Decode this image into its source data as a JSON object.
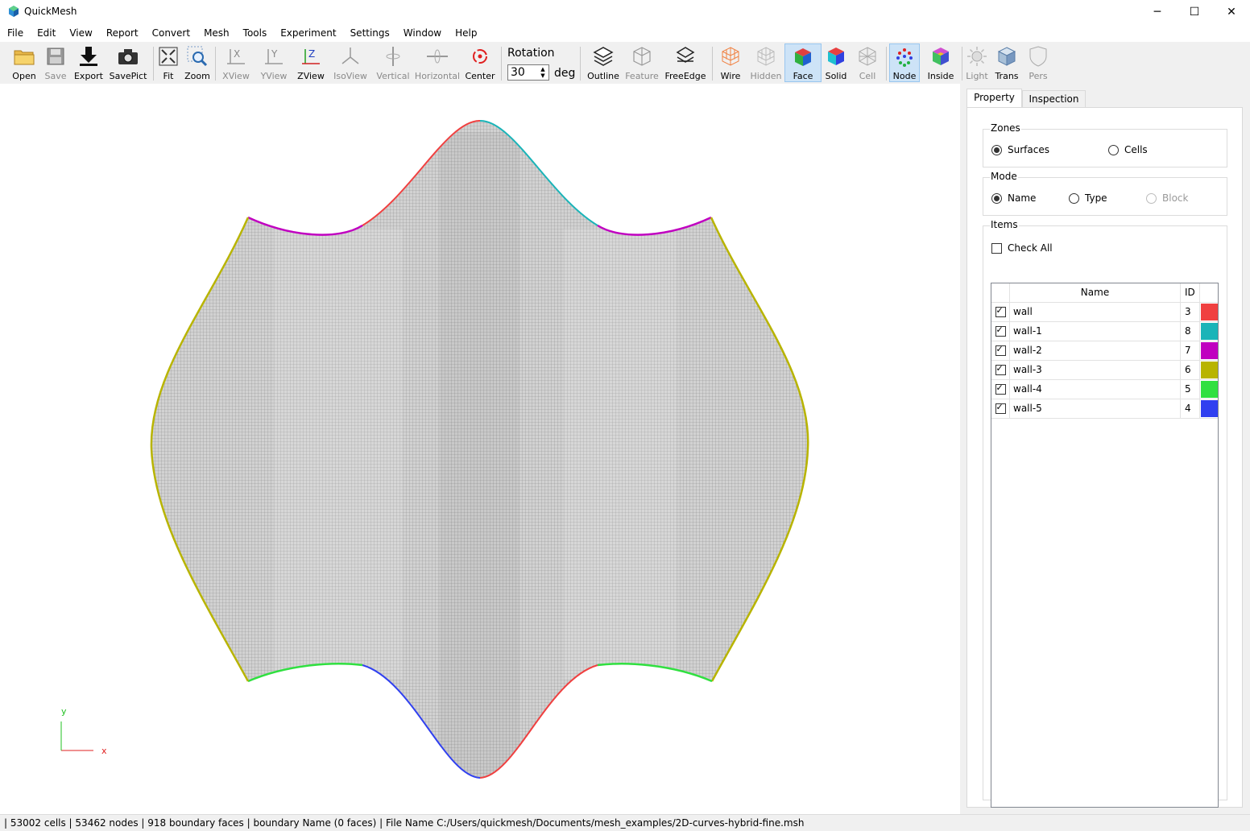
{
  "app": {
    "title": "QuickMesh"
  },
  "window_controls": {
    "minimize": "─",
    "maximize": "☐",
    "close": "✕"
  },
  "menu": [
    "File",
    "Edit",
    "View",
    "Report",
    "Convert",
    "Mesh",
    "Tools",
    "Experiment",
    "Settings",
    "Window",
    "Help"
  ],
  "toolbar": {
    "open": "Open",
    "save": "Save",
    "export": "Export",
    "savepict": "SavePict",
    "fit": "Fit",
    "zoom": "Zoom",
    "xview": "XView",
    "yview": "YView",
    "zview": "ZView",
    "isoview": "IsoView",
    "vertical": "Vertical",
    "horizontal": "Horizontal",
    "center": "Center",
    "rotation_label": "Rotation",
    "rotation_value": "30",
    "rotation_unit": "deg",
    "outline": "Outline",
    "feature": "Feature",
    "freeedge": "FreeEdge",
    "wire": "Wire",
    "hidden": "Hidden",
    "face": "Face",
    "solid": "Solid",
    "cell": "Cell",
    "node": "Node",
    "inside": "Inside",
    "light": "Light",
    "trans": "Trans",
    "pers": "Pers"
  },
  "axes": {
    "y": "y",
    "x": "x"
  },
  "panel": {
    "tabs": [
      "Property",
      "Inspection"
    ],
    "zones": {
      "title": "Zones",
      "surfaces": "Surfaces",
      "cells": "Cells",
      "selected": "Surfaces"
    },
    "mode": {
      "title": "Mode",
      "name": "Name",
      "type": "Type",
      "block": "Block",
      "selected": "Name"
    },
    "items": {
      "title": "Items",
      "check_all": "Check All",
      "headers": {
        "name": "Name",
        "id": "ID"
      },
      "rows": [
        {
          "name": "wall",
          "id": "3",
          "color": "#f04040",
          "checked": true
        },
        {
          "name": "wall-1",
          "id": "8",
          "color": "#1ab4b8",
          "checked": true
        },
        {
          "name": "wall-2",
          "id": "7",
          "color": "#c000c0",
          "checked": true
        },
        {
          "name": "wall-3",
          "id": "6",
          "color": "#b8b400",
          "checked": true
        },
        {
          "name": "wall-4",
          "id": "5",
          "color": "#30e040",
          "checked": true
        },
        {
          "name": "wall-5",
          "id": "4",
          "color": "#3040f0",
          "checked": true
        }
      ]
    }
  },
  "status": "| 53002 cells | 53462 nodes | 918 boundary faces |  boundary Name  (0 faces) | File Name C:/Users/quickmesh/Documents/mesh_examples/2D-curves-hybrid-fine.msh"
}
